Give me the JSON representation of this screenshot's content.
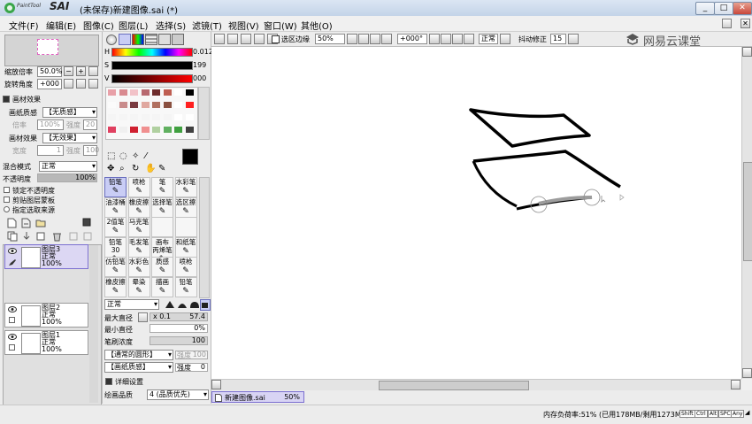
{
  "app": {
    "logo_small": "PaintTool",
    "logo_big": "SAI",
    "title": "(未保存)新建图像.sai (*)",
    "win_min": "_",
    "win_max": "□",
    "win_close": "✕",
    "sub_close": "✕"
  },
  "menu": [
    "文件(F)",
    "编辑(E)",
    "图像(C)",
    "图层(L)",
    "选择(S)",
    "滤镜(T)",
    "视图(V)",
    "窗口(W)",
    "其他(O)"
  ],
  "navigator": {
    "zoom_label": "缩放倍率",
    "zoom_value": "50.0%",
    "rotate_label": "旋转角度",
    "rotate_value": "+000",
    "btn_minus": "−",
    "btn_plus": "+",
    "btn_reset": "↺"
  },
  "paper": {
    "section_title": "画材效果",
    "texture_label": "画纸质感",
    "texture_value": "【无质感】",
    "scale_label": "倍率",
    "scale_value": "100%",
    "strength_label": "强度",
    "strength_value": "20",
    "effect_label": "画材效果",
    "effect_value": "【无效果】",
    "width_label": "宽度",
    "width_value": "1",
    "strength2_label": "强度",
    "strength2_value": "100"
  },
  "layer_props": {
    "blend_label": "混合模式",
    "blend_value": "正常",
    "opacity_label": "不透明度",
    "opacity_value": "100%",
    "opacity_fraction": 1.0,
    "lock_opacity": "锁定不透明度",
    "clip_group": "剪贴图层蒙板",
    "selection_source": "指定选取来源"
  },
  "layers": [
    {
      "name": "图层3",
      "mode": "正常",
      "opacity": "100%",
      "selected": true
    },
    {
      "name": "图层2",
      "mode": "正常",
      "opacity": "100%",
      "selected": false
    },
    {
      "name": "图层1",
      "mode": "正常",
      "opacity": "100%",
      "selected": false
    }
  ],
  "color": {
    "h_label": "H",
    "h_value": "0.012",
    "s_label": "S",
    "s_value": "199",
    "v_label": "V",
    "v_value": "000",
    "foreground": "#000000",
    "background": "#ffffff",
    "swatches": [
      "#e8a0a8",
      "#d98a90",
      "#f2c2c8",
      "#b86a70",
      "#6e2c2c",
      "#bf5e52",
      "#ffffff",
      "#000000",
      "#fbfbfb",
      "#c98c8c",
      "#7a3a40",
      "#e0a8a0",
      "#b07060",
      "#8a5040",
      "#ffffff",
      "#ff2020",
      "#f5f5f5",
      "#f5f5f5",
      "#f5f5f5",
      "#f5f5f5",
      "#f5f5f5",
      "#f5f5f5",
      "#ffffff",
      "#ffffff",
      "#e04060",
      "#f0f0f0",
      "#d02030",
      "#f09090",
      "#b0d0a0",
      "#60b060",
      "#40a040",
      "#404040"
    ]
  },
  "tools": [
    {
      "label": "铅笔",
      "selected": true
    },
    {
      "label": "喷枪",
      "selected": false
    },
    {
      "label": "笔",
      "selected": false
    },
    {
      "label": "水彩笔",
      "selected": false
    },
    {
      "label": "油漆桶",
      "selected": false
    },
    {
      "label": "橡皮擦",
      "selected": false
    },
    {
      "label": "选择笔",
      "selected": false
    },
    {
      "label": "选区擦",
      "selected": false
    },
    {
      "label": "2值笔",
      "selected": false
    },
    {
      "label": "马克笔",
      "selected": false
    },
    {
      "label": "",
      "selected": false
    },
    {
      "label": "",
      "selected": false
    },
    {
      "label": "铅笔30",
      "selected": false
    },
    {
      "label": "毛发笔",
      "selected": false
    },
    {
      "label": "画布 丙烯笔",
      "selected": false
    },
    {
      "label": "和纸笔",
      "selected": false
    },
    {
      "label": "仿铅笔",
      "selected": false
    },
    {
      "label": "水彩色",
      "selected": false
    },
    {
      "label": "质感",
      "selected": false
    },
    {
      "label": "喷枪",
      "selected": false
    },
    {
      "label": "橡皮擦",
      "selected": false
    },
    {
      "label": "晕染",
      "selected": false
    },
    {
      "label": "描画",
      "selected": false
    },
    {
      "label": "铅笔",
      "selected": false
    }
  ],
  "brush": {
    "mode_value": "正常",
    "max_size_label": "最大直径",
    "max_size_mult": "x 0.1",
    "max_size_value": "57.4",
    "min_size_label": "最小直径",
    "min_size_value": "0%",
    "density_label": "笔刷浓度",
    "density_value": "100",
    "shape_value": "【通常的圆形】",
    "shape_strength": "强度",
    "shape_strength_value": "100",
    "texture_value": "【画纸质感】",
    "texture_strength": "强度",
    "texture_strength_value": "0",
    "detail_label": "详细设置",
    "quality_label": "绘画品质",
    "quality_value": "4 (品质优先)"
  },
  "toolbar": {
    "sel_edge_label": "选区边缘",
    "zoom_value": "50%",
    "angle_value": "+000°",
    "mode_value": "正常",
    "stabilizer_label": "抖动修正",
    "stabilizer_value": "15",
    "watermark": "网易云课堂"
  },
  "doc_tab": {
    "name": "新建图像.sai",
    "zoom": "50%"
  },
  "status": {
    "memory": "内存负荷率:51% (已用178MB/剩用1273MB)",
    "keys": [
      "Shift",
      "Ctrl",
      "Alt",
      "SPC",
      "Any"
    ]
  },
  "colors": {
    "accent_layer": "#dcd7f3",
    "selected_tool": "#c9cdf5"
  }
}
